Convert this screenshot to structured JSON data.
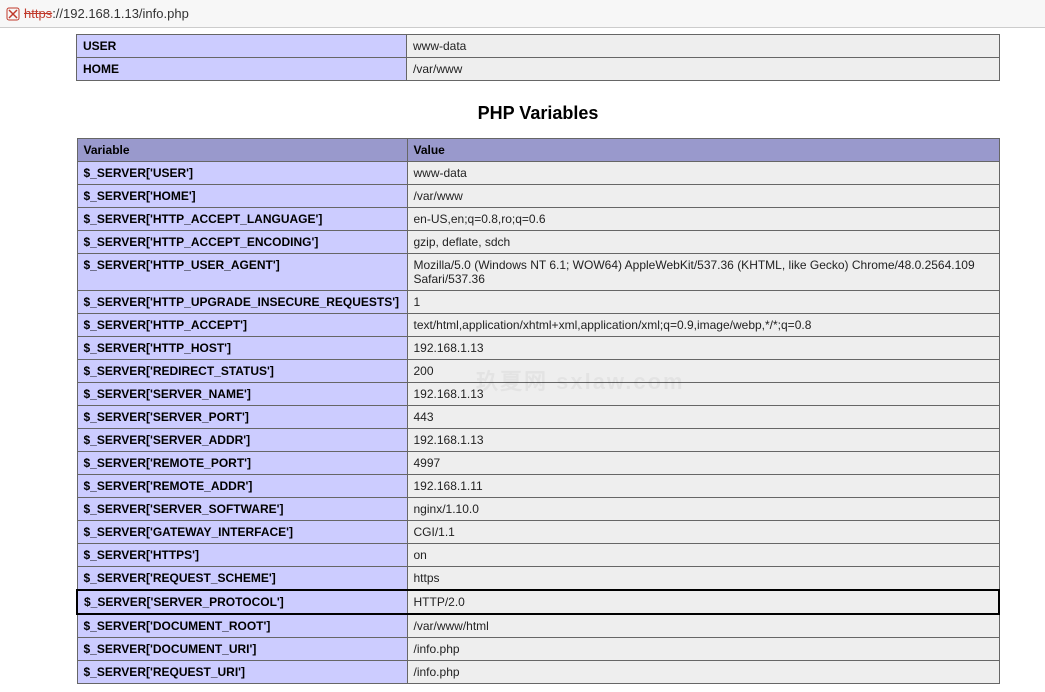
{
  "address_bar": {
    "scheme_struck": "https",
    "rest": "://192.168.1.13/info.php"
  },
  "env_table": [
    {
      "key": "USER",
      "value": "www-data"
    },
    {
      "key": "HOME",
      "value": "/var/www"
    }
  ],
  "section_title": "PHP Variables",
  "vars_table": {
    "headers": {
      "variable": "Variable",
      "value": "Value"
    },
    "rows": [
      {
        "key": "$_SERVER['USER']",
        "value": "www-data"
      },
      {
        "key": "$_SERVER['HOME']",
        "value": "/var/www"
      },
      {
        "key": "$_SERVER['HTTP_ACCEPT_LANGUAGE']",
        "value": "en-US,en;q=0.8,ro;q=0.6"
      },
      {
        "key": "$_SERVER['HTTP_ACCEPT_ENCODING']",
        "value": "gzip, deflate, sdch"
      },
      {
        "key": "$_SERVER['HTTP_USER_AGENT']",
        "value": "Mozilla/5.0 (Windows NT 6.1; WOW64) AppleWebKit/537.36 (KHTML, like Gecko) Chrome/48.0.2564.109 Safari/537.36"
      },
      {
        "key": "$_SERVER['HTTP_UPGRADE_INSECURE_REQUESTS']",
        "value": "1"
      },
      {
        "key": "$_SERVER['HTTP_ACCEPT']",
        "value": "text/html,application/xhtml+xml,application/xml;q=0.9,image/webp,*/*;q=0.8"
      },
      {
        "key": "$_SERVER['HTTP_HOST']",
        "value": "192.168.1.13"
      },
      {
        "key": "$_SERVER['REDIRECT_STATUS']",
        "value": "200"
      },
      {
        "key": "$_SERVER['SERVER_NAME']",
        "value": "192.168.1.13"
      },
      {
        "key": "$_SERVER['SERVER_PORT']",
        "value": "443"
      },
      {
        "key": "$_SERVER['SERVER_ADDR']",
        "value": "192.168.1.13"
      },
      {
        "key": "$_SERVER['REMOTE_PORT']",
        "value": "4997"
      },
      {
        "key": "$_SERVER['REMOTE_ADDR']",
        "value": "192.168.1.11"
      },
      {
        "key": "$_SERVER['SERVER_SOFTWARE']",
        "value": "nginx/1.10.0"
      },
      {
        "key": "$_SERVER['GATEWAY_INTERFACE']",
        "value": "CGI/1.1"
      },
      {
        "key": "$_SERVER['HTTPS']",
        "value": "on"
      },
      {
        "key": "$_SERVER['REQUEST_SCHEME']",
        "value": "https"
      },
      {
        "key": "$_SERVER['SERVER_PROTOCOL']",
        "value": "HTTP/2.0",
        "highlight": true
      },
      {
        "key": "$_SERVER['DOCUMENT_ROOT']",
        "value": "/var/www/html"
      },
      {
        "key": "$_SERVER['DOCUMENT_URI']",
        "value": "/info.php"
      },
      {
        "key": "$_SERVER['REQUEST_URI']",
        "value": "/info.php"
      }
    ]
  },
  "watermark": "玖夏网 sxlaw.com"
}
